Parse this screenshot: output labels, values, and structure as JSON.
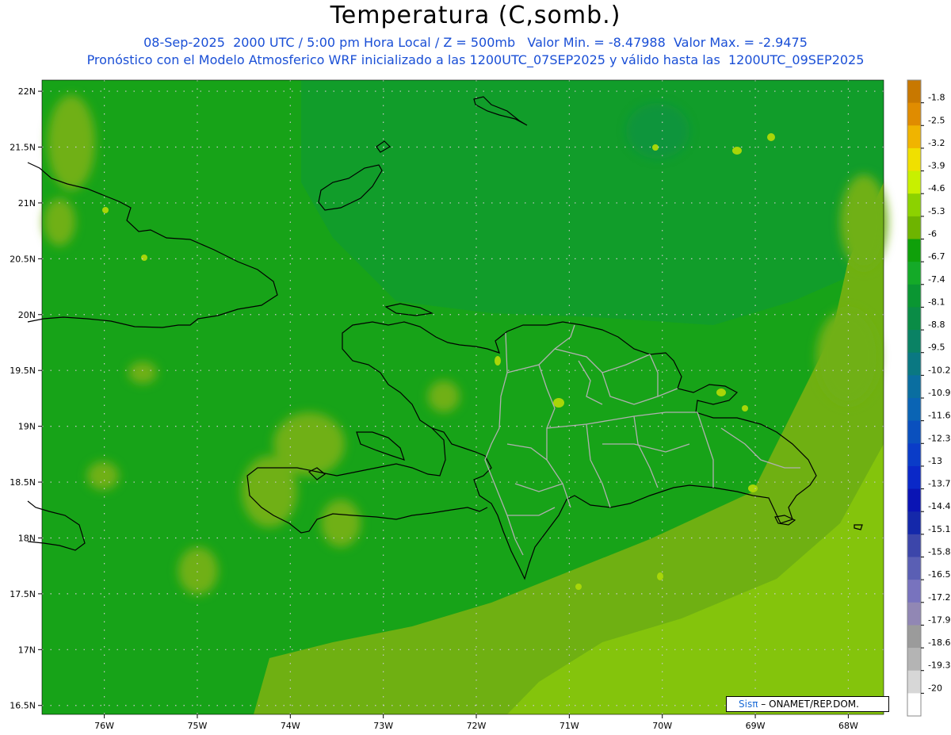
{
  "header": {
    "title": "Temperatura (C,somb.)",
    "line1": "08-Sep-2025  2000 UTC / 5:00 pm Hora Local / Z = 500mb   Valor Min. = -8.47988  Valor Max. = -2.9475",
    "line2": "Pronóstico con el Modelo Atmosferico WRF inicializado a las 1200UTC_07SEP2025 y válido hasta las  1200UTC_09SEP2025"
  },
  "map": {
    "lat_labels": [
      "22N",
      "21.5N",
      "21N",
      "20.5N",
      "20N",
      "19.5N",
      "19N",
      "18.5N",
      "18N",
      "17.5N",
      "17N",
      "16.5N"
    ],
    "lat_values": [
      22,
      21.5,
      21,
      20.5,
      20,
      19.5,
      19,
      18.5,
      18,
      17.5,
      17,
      16.5
    ],
    "lon_labels": [
      "76W",
      "75W",
      "74W",
      "73W",
      "72W",
      "71W",
      "70W",
      "69W",
      "68W"
    ],
    "lon_values": [
      -76,
      -75,
      -74,
      -73,
      -72,
      -71,
      -70,
      -69,
      -68
    ],
    "lat_range": [
      16.42,
      22.1
    ],
    "lon_range": [
      -76.67,
      -67.62
    ],
    "colors": {
      "base_field": "#17a318",
      "north_field": "#119c2e",
      "south_field": "#6fb012",
      "far_south_field": "#84c40c",
      "coastline": "#000000",
      "provinces": "#b0b0b0",
      "gridline": "#c8c8c8"
    }
  },
  "colorbar": {
    "labels": [
      "-1.8",
      "-2.5",
      "-3.2",
      "-3.9",
      "-4.6",
      "-5.3",
      "-6",
      "-6.7",
      "-7.4",
      "-8.1",
      "-8.8",
      "-9.5",
      "-10.2",
      "-10.9",
      "-11.6",
      "-12.3",
      "-13",
      "-13.7",
      "-14.4",
      "-15.1",
      "-15.8",
      "-16.5",
      "-17.2",
      "-17.9",
      "-18.6",
      "-19.3",
      "-20"
    ],
    "colors": [
      "#c87800",
      "#e08c00",
      "#f0b400",
      "#f0e000",
      "#c8f000",
      "#8cd200",
      "#6eb400",
      "#0fa00a",
      "#14aa28",
      "#0a9632",
      "#0a8c46",
      "#0a8264",
      "#0a7882",
      "#0a6ea0",
      "#0a64b4",
      "#0a50be",
      "#0a3cc8",
      "#0a28c8",
      "#0a14b4",
      "#1428aa",
      "#3c46aa",
      "#5a5fb4",
      "#7873be",
      "#9187b4",
      "#9b9b9b",
      "#b4b4b4",
      "#d7d7d7",
      "#ffffff"
    ]
  },
  "footer": {
    "credit_logo": "Sisπ",
    "credit_text": " – ONAMET/REP.DOM."
  }
}
